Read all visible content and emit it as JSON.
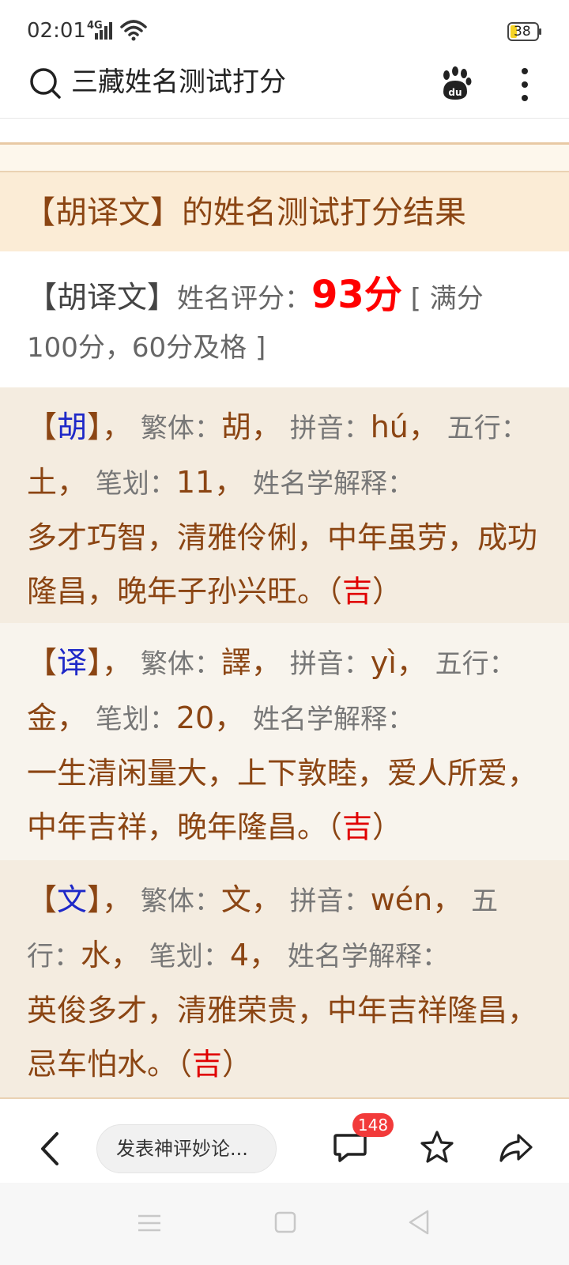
{
  "status_bar": {
    "time": "02:01",
    "signal": "4G",
    "battery": "38"
  },
  "search_bar": {
    "query": "三藏姓名测试打分",
    "search_icon": "search-icon",
    "baidu_icon": "baidu-paw-icon",
    "menu_icon": "more-vertical-icon"
  },
  "result": {
    "title": "【胡译文】的姓名测试打分结果",
    "score_name": "【胡译文】",
    "score_label": "姓名评分：",
    "score_value": "93分",
    "score_note_1": " [ 满分",
    "score_note_2": "100分，60分及格 ]"
  },
  "characters": [
    {
      "char": "胡",
      "traditional_label": "繁体：",
      "traditional": "胡",
      "pinyin_label": "拼音：",
      "pinyin": "hú",
      "wuxing_label": "五行：",
      "wuxing": "土",
      "strokes_label": "笔划：",
      "strokes": "11",
      "explain_label": "姓名学解释：",
      "explanation": "多才巧智，清雅伶俐，中年虽劳，成功隆昌，晚年子孙兴旺。",
      "luck": "吉"
    },
    {
      "char": "译",
      "traditional_label": "繁体：",
      "traditional": "譯",
      "pinyin_label": "拼音：",
      "pinyin": "yì",
      "wuxing_label": "五行：",
      "wuxing": "金",
      "strokes_label": "笔划：",
      "strokes": "20",
      "explain_label": "姓名学解释：",
      "explanation": "一生清闲量大，上下敦睦，爱人所爱，中年吉祥，晚年隆昌。",
      "luck": "吉"
    },
    {
      "char": "文",
      "traditional_label": "繁体：",
      "traditional": "文",
      "pinyin_label": "拼音：",
      "pinyin": "wén",
      "wuxing_label": "五行：",
      "wuxing": "水",
      "strokes_label": "笔划：",
      "strokes": "4",
      "explain_label": "姓名学解释：",
      "explanation": "英俊多才，清雅荣贵，中年吉祥隆昌，忌车怕水。",
      "luck": "吉"
    }
  ],
  "bottom_bar": {
    "comment_placeholder": "发表神评妙论...",
    "comment_count": "148",
    "back_icon": "chevron-left-icon",
    "comment_icon": "comment-bubble-icon",
    "favorite_icon": "star-icon",
    "share_icon": "share-arrow-icon"
  },
  "nav_bar": {
    "menu_icon": "nav-menu-icon",
    "home_icon": "nav-home-icon",
    "back_icon": "nav-back-icon"
  },
  "colors": {
    "title_brown": "#8b4513",
    "score_red": "#ff0000",
    "char_blue": "#1e28c8",
    "header_bg": "#fbecd6",
    "block_bg": "#f4ece0",
    "badge_red": "#f23a3a"
  }
}
